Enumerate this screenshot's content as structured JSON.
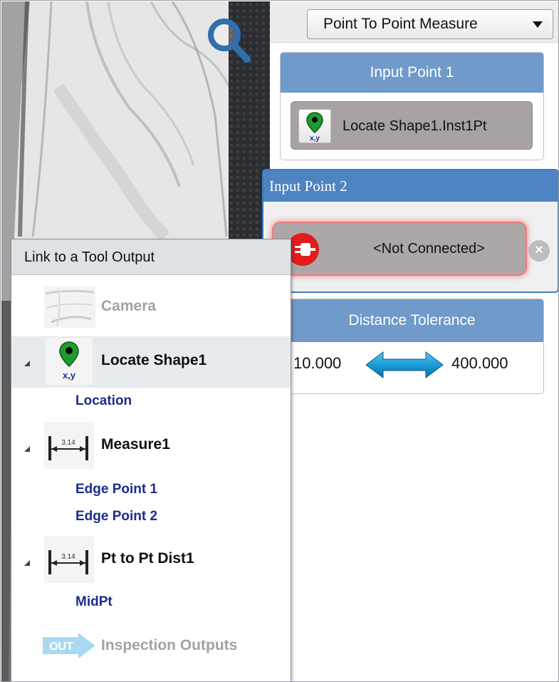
{
  "mode_select": {
    "value": "Point To Point Measure"
  },
  "input_point_1": {
    "title": "Input Point 1",
    "value": "Locate Shape1.Inst1Pt"
  },
  "input_point_2": {
    "title": "Input Point 2",
    "value": "<Not Connected>"
  },
  "distance_tolerance": {
    "title": "Distance Tolerance",
    "min": "10.000",
    "max": "400.000"
  },
  "link_popup": {
    "title": "Link to a Tool Output",
    "items": [
      {
        "label": "Camera",
        "icon": "camera-image-icon",
        "enabled": false
      },
      {
        "label": "Locate Shape1",
        "icon": "map-pin-icon",
        "expanded": true,
        "children": [
          "Location"
        ]
      },
      {
        "label": "Measure1",
        "icon": "caliper-icon",
        "expanded": true,
        "children": [
          "Edge Point 1",
          "Edge Point 2"
        ]
      },
      {
        "label": "Pt to Pt Dist1",
        "icon": "caliper-icon",
        "expanded": true,
        "children": [
          "MidPt"
        ]
      },
      {
        "label": "Inspection Outputs",
        "icon": "out-arrow-icon",
        "enabled": false
      }
    ]
  },
  "colors": {
    "header_blue": "#6f9ac9",
    "active_blue": "#3b7cc3",
    "link_text": "#1c2c8c",
    "error_red": "#e11c1c"
  }
}
